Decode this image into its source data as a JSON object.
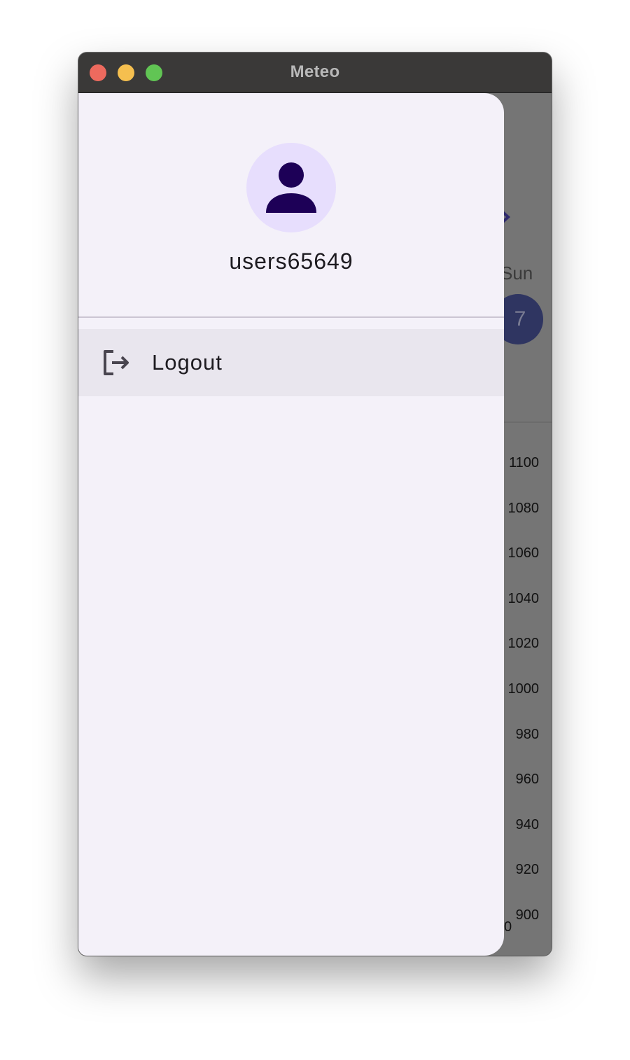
{
  "window": {
    "title": "Meteo"
  },
  "drawer": {
    "username": "users65649",
    "menu": [
      {
        "label": "Logout",
        "icon": "logout-icon"
      }
    ]
  },
  "background": {
    "day_label": "Sun",
    "date_number": "7",
    "axis_ticks": [
      "1100",
      "1080",
      "1060",
      "1040",
      "1020",
      "1000",
      "980",
      "960",
      "940",
      "920",
      "900"
    ],
    "bottom_label": "0"
  },
  "colors": {
    "drawer_bg": "#f4f1f9",
    "avatar_bg": "#e7defd",
    "avatar_icon": "#1d0057",
    "selected_item_bg": "#e9e6ee",
    "scrim": "#757575"
  }
}
